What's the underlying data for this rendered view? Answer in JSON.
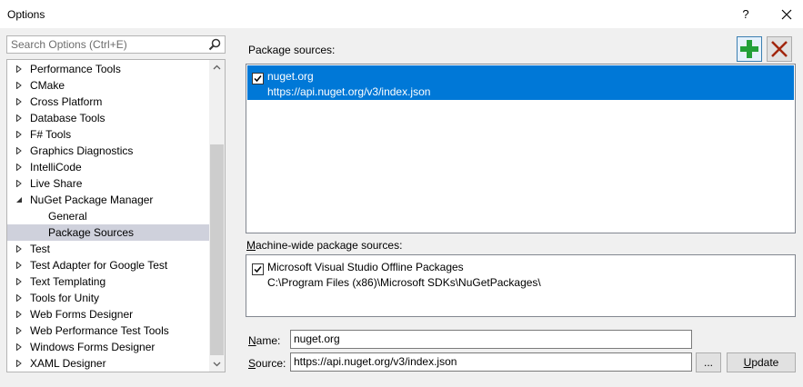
{
  "window": {
    "title": "Options",
    "help_label": "?",
    "close_label": "✕"
  },
  "search": {
    "placeholder": "Search Options (Ctrl+E)"
  },
  "tree": {
    "items": [
      {
        "label": "Performance Tools",
        "expanded": false
      },
      {
        "label": "CMake",
        "expanded": false
      },
      {
        "label": "Cross Platform",
        "expanded": false
      },
      {
        "label": "Database Tools",
        "expanded": false
      },
      {
        "label": "F# Tools",
        "expanded": false
      },
      {
        "label": "Graphics Diagnostics",
        "expanded": false
      },
      {
        "label": "IntelliCode",
        "expanded": false
      },
      {
        "label": "Live Share",
        "expanded": false
      },
      {
        "label": "NuGet Package Manager",
        "expanded": true
      },
      {
        "label": "General",
        "child": true
      },
      {
        "label": "Package Sources",
        "child": true,
        "selected": true
      },
      {
        "label": "Test",
        "expanded": false
      },
      {
        "label": "Test Adapter for Google Test",
        "expanded": false
      },
      {
        "label": "Text Templating",
        "expanded": false
      },
      {
        "label": "Tools for Unity",
        "expanded": false
      },
      {
        "label": "Web Forms Designer",
        "expanded": false
      },
      {
        "label": "Web Performance Test Tools",
        "expanded": false
      },
      {
        "label": "Windows Forms Designer",
        "expanded": false
      },
      {
        "label": "XAML Designer",
        "expanded": false
      }
    ]
  },
  "package_sources": {
    "label": "Package sources:",
    "items": [
      {
        "name": "nuget.org",
        "url": "https://api.nuget.org/v3/index.json",
        "checked": true,
        "selected": true
      }
    ]
  },
  "machine_sources": {
    "label": "Machine-wide package sources:",
    "items": [
      {
        "name": "Microsoft Visual Studio Offline Packages",
        "path": "C:\\Program Files (x86)\\Microsoft SDKs\\NuGetPackages\\",
        "checked": true
      }
    ]
  },
  "form": {
    "name_label": "Name:",
    "name_value": "nuget.org",
    "source_label": "Source:",
    "source_value": "https://api.nuget.org/v3/index.json",
    "browse_label": "...",
    "update_label": "Update"
  },
  "colors": {
    "selection": "#0078d7",
    "tree_selection": "#cfd1dc",
    "add_icon": "#22a039",
    "remove_icon": "#a1260d"
  },
  "icons": {
    "add": "plus-icon",
    "remove": "x-icon",
    "search": "magnifier-icon"
  }
}
